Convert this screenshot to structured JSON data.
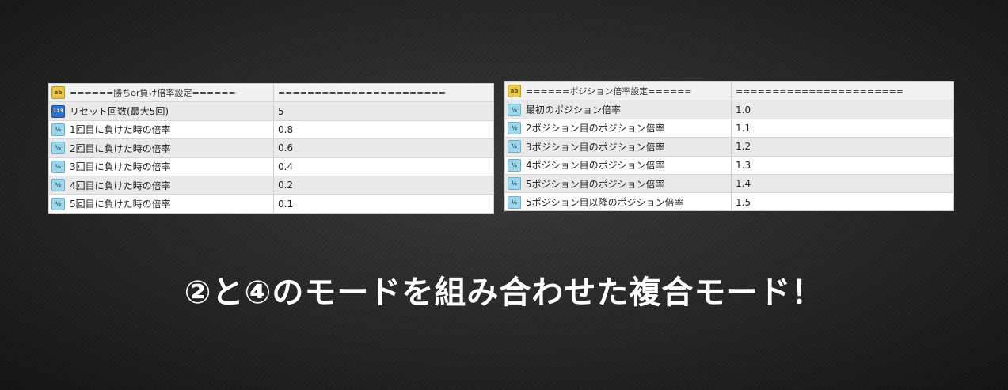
{
  "left_table": {
    "header": {
      "name": "======勝ちor負け倍率設定======",
      "value": "======================="
    },
    "rows": [
      {
        "icon": "integer-icon",
        "name": "リセット回数(最大5回)",
        "value": "5"
      },
      {
        "icon": "fraction-icon",
        "name": "1回目に負けた時の倍率",
        "value": "0.8"
      },
      {
        "icon": "fraction-icon",
        "name": "2回目に負けた時の倍率",
        "value": "0.6"
      },
      {
        "icon": "fraction-icon",
        "name": "3回目に負けた時の倍率",
        "value": "0.4"
      },
      {
        "icon": "fraction-icon",
        "name": "4回目に負けた時の倍率",
        "value": "0.2"
      },
      {
        "icon": "fraction-icon",
        "name": "5回目に負けた時の倍率",
        "value": "0.1"
      }
    ]
  },
  "right_table": {
    "header": {
      "name": "======ポジション倍率設定======",
      "value": "======================="
    },
    "rows": [
      {
        "icon": "fraction-icon",
        "name": "最初のポジション倍率",
        "value": "1.0"
      },
      {
        "icon": "fraction-icon",
        "name": "2ポジション目のポジション倍率",
        "value": "1.1"
      },
      {
        "icon": "fraction-icon",
        "name": "3ポジション目のポジション倍率",
        "value": "1.2"
      },
      {
        "icon": "fraction-icon",
        "name": "4ポジション目のポジション倍率",
        "value": "1.3"
      },
      {
        "icon": "fraction-icon",
        "name": "5ポジション目のポジション倍率",
        "value": "1.4"
      },
      {
        "icon": "fraction-icon",
        "name": "5ポジション目以降のポジション倍率",
        "value": "1.5"
      }
    ]
  },
  "icons": {
    "string": "ab",
    "integer": "123",
    "fraction": "½"
  },
  "caption": "②と④のモードを組み合わせた複合モード！",
  "colors": {
    "string_icon": "#e8c84a",
    "integer_icon": "#2f6fcf",
    "fraction_icon": "#9fd6ea",
    "caption_text": "#ffffff"
  }
}
